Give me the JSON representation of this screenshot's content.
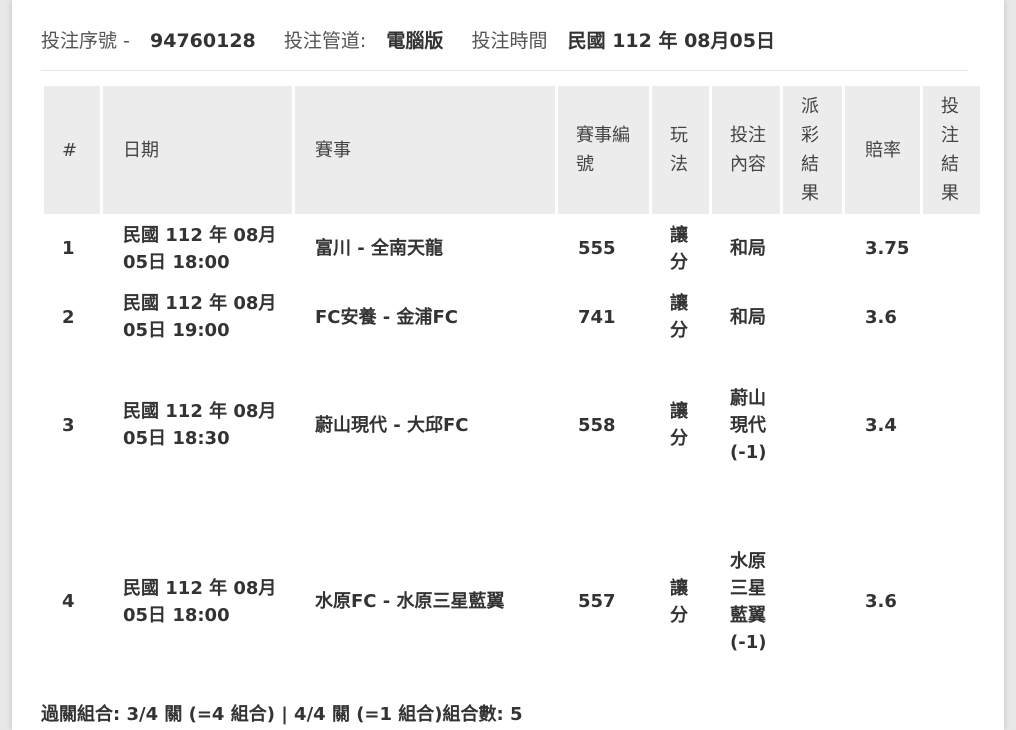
{
  "info": {
    "serial_label": "投注序號 -",
    "serial_value": "94760128",
    "channel_label": "投注管道:",
    "channel_value": "電腦版",
    "time_label": "投注時間",
    "time_value": "民國 112 年 08月05日"
  },
  "table": {
    "headers": {
      "num": "#",
      "date": "日期",
      "match": "賽事",
      "code": "賽事編號",
      "play": "玩法",
      "content": "投注內容",
      "dispatch": "派彩結果",
      "odds": "賠率",
      "result": "投注結果"
    },
    "rows": [
      {
        "num": "1",
        "date_line1": "民國 112 年 08月",
        "date_line2": "05日 18:00",
        "match": "富川 - 全南天龍",
        "code": "555",
        "play": "讓分",
        "content": "和局",
        "dispatch": "",
        "odds": "3.75",
        "result": ""
      },
      {
        "num": "2",
        "date_line1": "民國 112 年 08月",
        "date_line2": "05日 19:00",
        "match": "FC安養 - 金浦FC",
        "code": "741",
        "play": "讓分",
        "content": "和局",
        "dispatch": "",
        "odds": "3.6",
        "result": ""
      },
      {
        "num": "3",
        "date_line1": "民國 112 年 08月",
        "date_line2": "05日 18:30",
        "match": "蔚山現代 - 大邱FC",
        "code": "558",
        "play": "讓分",
        "content": "蔚山現代(-1)",
        "dispatch": "",
        "odds": "3.4",
        "result": ""
      },
      {
        "num": "4",
        "date_line1": "民國 112 年 08月",
        "date_line2": "05日 18:00",
        "match": "水原FC - 水原三星藍翼",
        "code": "557",
        "play": "讓分",
        "content": "水原三星藍翼(-1)",
        "dispatch": "",
        "odds": "3.6",
        "result": ""
      }
    ]
  },
  "footer": {
    "summary": "過關組合: 3/4 關 (=4 組合) | 4/4 關 (=1 組合)組合數: 5"
  }
}
